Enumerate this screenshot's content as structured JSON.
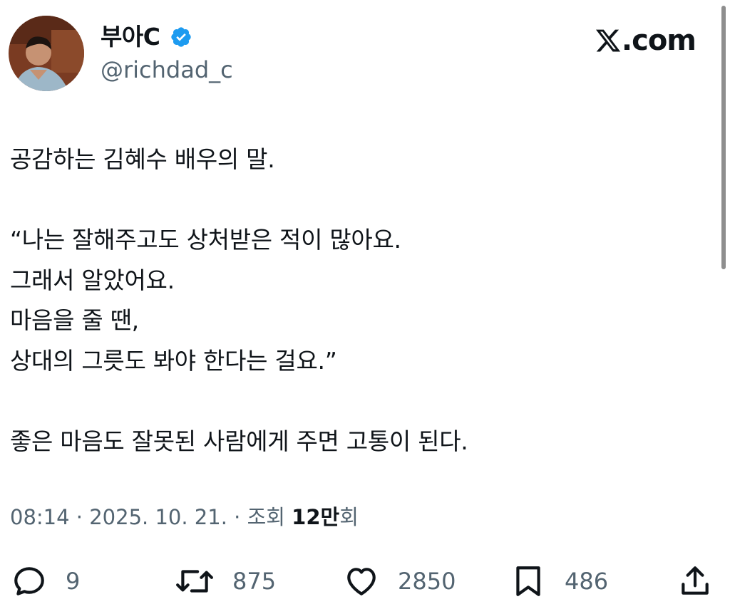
{
  "header": {
    "display_name": "부아C",
    "handle": "@richdad_c",
    "site": ".com",
    "verified_color": "#1d9bf0"
  },
  "tweet": {
    "lines": [
      "공감하는 김혜수 배우의 말.",
      "“나는 잘해주고도 상처받은 적이 많아요.",
      "그래서 알았어요.",
      "마음을 줄 땐,",
      "상대의 그릇도 봐야 한다는 걸요.”",
      "좋은 마음도 잘못된 사람에게 주면 고통이 된다."
    ]
  },
  "meta": {
    "time": "08:14 · 2025. 10. 21. · 조회 ",
    "views": "12만",
    "views_suffix": "회"
  },
  "actions": {
    "replies": "9",
    "retweets": "875",
    "likes": "2850",
    "bookmarks": "486"
  },
  "icons": [
    "verified-badge-icon",
    "x-logo-icon",
    "reply-icon",
    "retweet-icon",
    "like-icon",
    "bookmark-icon",
    "share-icon"
  ],
  "colors": {
    "text": "#0f1419",
    "secondary": "#536471",
    "verified": "#1d9bf0"
  }
}
